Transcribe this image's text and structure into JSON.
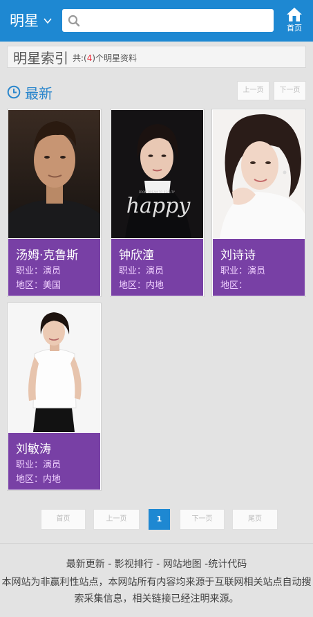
{
  "header": {
    "brand": "明星",
    "search_placeholder": "",
    "home_label": "首页"
  },
  "index_bar": {
    "title": "明星索引",
    "count_prefix": "共:(",
    "count": "4",
    "count_suffix": ")个明星资料"
  },
  "section": {
    "title": "最新",
    "prev_label": "上一页",
    "next_label": "下一页"
  },
  "stars": [
    {
      "name": "汤姆·克鲁斯",
      "job": "职业：演员",
      "region": "地区：美国"
    },
    {
      "name": "钟欣潼",
      "job": "职业：演员",
      "region": "地区：内地"
    },
    {
      "name": "刘诗诗",
      "job": "职业：演员",
      "region": "地区："
    },
    {
      "name": "刘敏涛",
      "job": "职业：演员",
      "region": "地区：内地"
    }
  ],
  "photo_text": {
    "poster": "happy",
    "poster_small": "FROM DREAM TO REALITY"
  },
  "pagination": {
    "first": "首页",
    "prev": "上一页",
    "current": "1",
    "next": "下一页",
    "last": "尾页"
  },
  "footer": {
    "link1": "最新更新",
    "sep1": " - ",
    "link2": "影视排行",
    "sep2": " - ",
    "link3": "网站地图",
    "sep3": " -",
    "link4": "统计代码",
    "note": "本网站为非赢利性站点，本网站所有内容均来源于互联网相关站点自动搜索采集信息，相关链接已经注明来源。"
  },
  "colors": {
    "header": "#1e88d2",
    "card_info": "#7840a5",
    "accent_title": "#2a86cc",
    "count_red": "#e22233"
  }
}
